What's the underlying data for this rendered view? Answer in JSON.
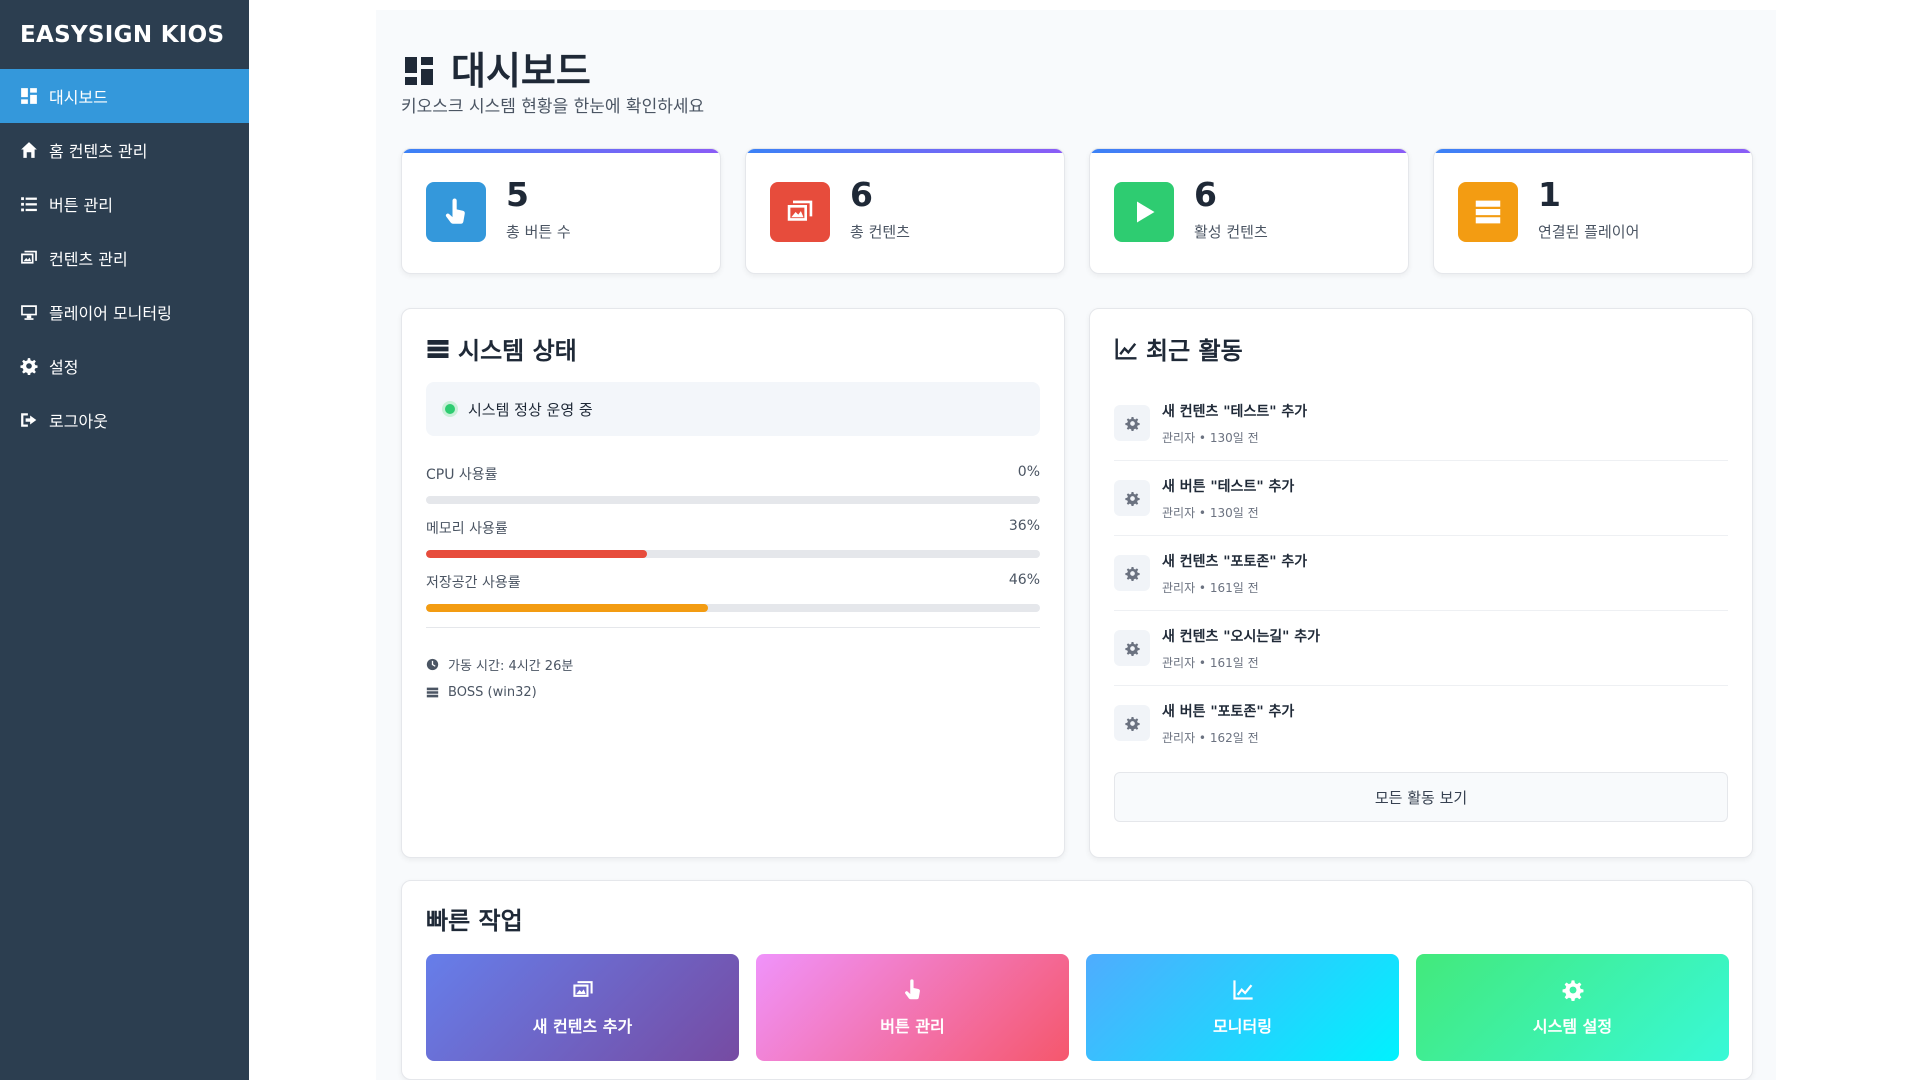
{
  "sidebar": {
    "brand": "EASYSIGN KIOS",
    "items": [
      {
        "label": "대시보드",
        "icon": "dashboard-icon"
      },
      {
        "label": "홈 컨텐츠 관리",
        "icon": "home-icon"
      },
      {
        "label": "버튼 관리",
        "icon": "list-icon"
      },
      {
        "label": "컨텐츠 관리",
        "icon": "images-icon"
      },
      {
        "label": "플레이어 모니터링",
        "icon": "monitor-icon"
      },
      {
        "label": "설정",
        "icon": "gear-icon"
      },
      {
        "label": "로그아웃",
        "icon": "logout-icon"
      }
    ],
    "active_index": 0
  },
  "header": {
    "title": "대시보드",
    "subtitle": "키오스크 시스템 현황을 한눈에 확인하세요"
  },
  "stats": [
    {
      "value": "5",
      "label": "총 버튼 수",
      "color": "#3498db",
      "icon": "pointer-icon"
    },
    {
      "value": "6",
      "label": "총 컨텐츠",
      "color": "#e74c3c",
      "icon": "images-icon"
    },
    {
      "value": "6",
      "label": "활성 컨텐츠",
      "color": "#2ecc71",
      "icon": "play-icon"
    },
    {
      "value": "1",
      "label": "연결된 플레이어",
      "color": "#f39c12",
      "icon": "server-icon"
    }
  ],
  "system": {
    "title": "시스템 상태",
    "status_text": "시스템 정상 운영 중",
    "metrics": [
      {
        "label": "CPU 사용률",
        "value": "0%",
        "fraction": 0,
        "color": "#3498db"
      },
      {
        "label": "메모리 사용률",
        "value": "36%",
        "fraction": 0.36,
        "color": "#e74c3c"
      },
      {
        "label": "저장공간 사용률",
        "value": "46%",
        "fraction": 0.46,
        "color": "#f39c12"
      }
    ],
    "uptime": "가동 시간: 4시간 26분",
    "host": "BOSS (win32)"
  },
  "activity": {
    "title": "최근 활동",
    "items": [
      {
        "text": "새 컨텐츠 \"테스트\" 추가",
        "meta": "관리자 • 130일 전"
      },
      {
        "text": "새 버튼 \"테스트\" 추가",
        "meta": "관리자 • 130일 전"
      },
      {
        "text": "새 컨텐츠 \"포토존\" 추가",
        "meta": "관리자 • 161일 전"
      },
      {
        "text": "새 컨텐츠 \"오시는길\" 추가",
        "meta": "관리자 • 161일 전"
      },
      {
        "text": "새 버튼 \"포토존\" 추가",
        "meta": "관리자 • 162일 전"
      }
    ],
    "view_all": "모든 활동 보기"
  },
  "quick": {
    "title": "빠른 작업",
    "buttons": [
      {
        "label": "새 컨텐츠 추가",
        "icon": "images-icon"
      },
      {
        "label": "버튼 관리",
        "icon": "pointer-icon"
      },
      {
        "label": "모니터링",
        "icon": "chart-line-icon"
      },
      {
        "label": "시스템 설정",
        "icon": "gear-icon"
      }
    ]
  }
}
